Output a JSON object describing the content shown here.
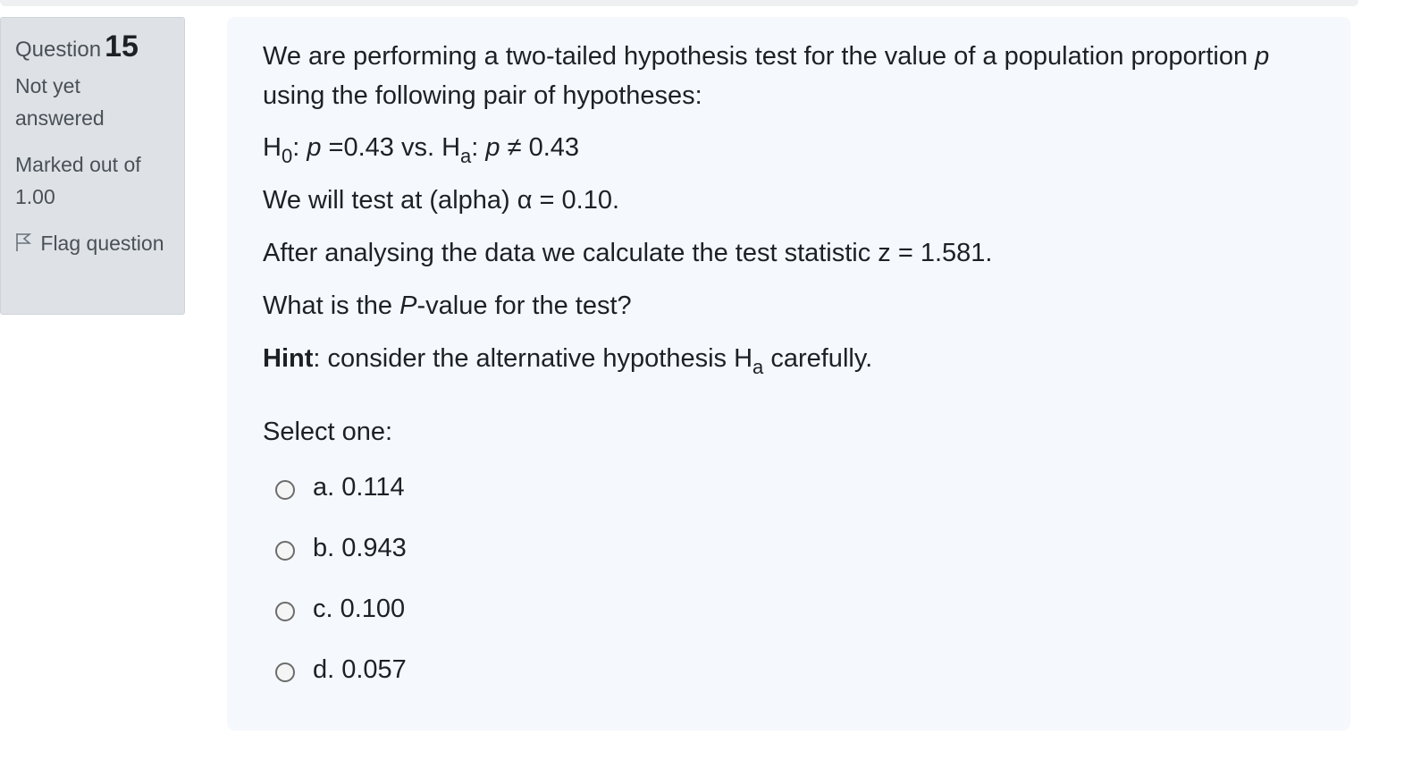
{
  "info": {
    "question_label": "Question",
    "question_number": "15",
    "state": "Not yet answered",
    "grade": "Marked out of 1.00",
    "flag_label": "Flag question"
  },
  "question": {
    "intro_1": "We are performing a two-tailed hypothesis test for the value of a population proportion ",
    "intro_p": "p",
    "intro_2": " using the following pair of hypotheses:",
    "h0": "H",
    "h0_sub": "0",
    "h0_rest_1": ": ",
    "h0_p": "p",
    "h0_rest_2": " =0.43 vs. H",
    "ha_sub": "a",
    "ha_rest_1": ": ",
    "ha_p": "p",
    "ha_rest_2": " ≠ 0.43",
    "alpha": "We will test at (alpha) α = 0.10.",
    "stat": "After analysing the data we calculate the test statistic z = 1.581.",
    "ask_1": "What is the ",
    "ask_p": "P",
    "ask_2": "-value for the test?",
    "hint_bold": "Hint",
    "hint_text": ": consider the alternative hypothesis H",
    "hint_sub": "a",
    "hint_end": " carefully."
  },
  "answer": {
    "prompt": "Select one:",
    "options": [
      {
        "label": "a. 0.114"
      },
      {
        "label": "b. 0.943"
      },
      {
        "label": "c. 0.100"
      },
      {
        "label": "d. 0.057"
      }
    ]
  },
  "icons": {
    "flag": "flag-icon",
    "radio": "radio-button"
  }
}
